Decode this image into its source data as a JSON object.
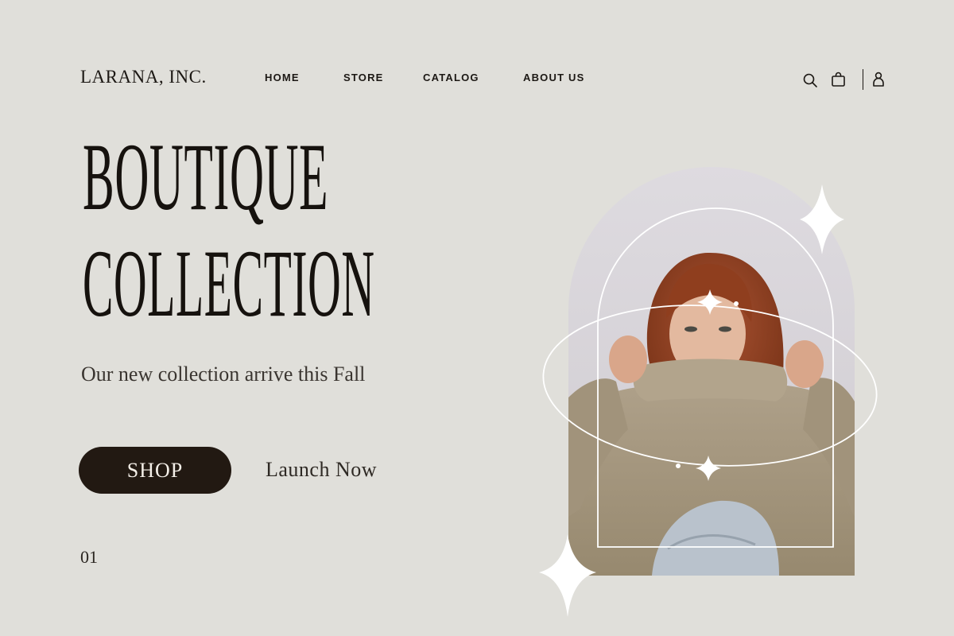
{
  "header": {
    "logo": "LARANA, INC.",
    "nav": [
      {
        "label": "HOME"
      },
      {
        "label": "STORE"
      },
      {
        "label": "CATALOG"
      },
      {
        "label": "ABOUT US"
      }
    ],
    "icons": [
      "search-icon",
      "shopping-bag-icon",
      "user-icon"
    ]
  },
  "hero": {
    "title_line1": "BOUTIQUE",
    "title_line2": "COLLECTION",
    "subtitle": "Our new collection arrive this Fall",
    "shop_button": "SHOP",
    "launch_link": "Launch Now",
    "page_number": "01"
  },
  "image": {
    "description": "woman-in-beige-hoodie-photo"
  },
  "colors": {
    "background": "#e0dfda",
    "button": "#221912",
    "arch_backdrop": "#d9d6da",
    "hoodie": "#a89a84"
  }
}
